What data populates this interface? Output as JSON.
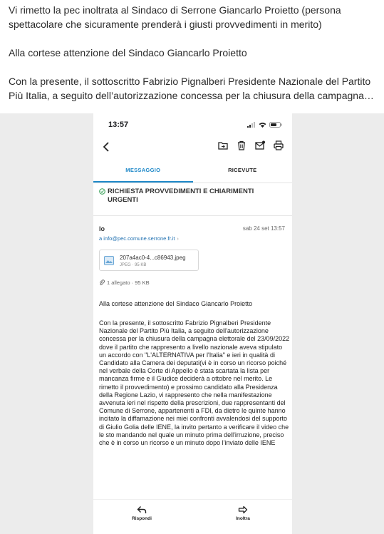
{
  "post": {
    "paragraph1": "Vi rimetto la pec inoltrata al Sindaco di Serrone Giancarlo Proietto (persona spettacolare che sicuramente prenderà i giusti provvedimenti in merito)",
    "paragraph2": "Alla cortese attenzione del Sindaco Giancarlo Proietto",
    "paragraph3": "Con la presente, il sottoscritto Fabrizio Pignalberi Presidente Nazionale del Partito Più Italia, a seguito dell’autorizzazione concessa per la chiusura della campagna…"
  },
  "phone": {
    "status_time": "13:57",
    "tabs": [
      "MESSAGGIO",
      "RICEVUTE"
    ],
    "subject": "RICHIESTA PROVVEDIMENTI E CHIARIMENTI URGENTI",
    "sender": "Io",
    "date": "sab 24 set 13:57",
    "recipient": "a info@pec.comune.serrone.fr.it",
    "recipient_arrow": "›",
    "attachment": {
      "name": "207a4ac0-4...c86943.jpeg",
      "meta": "JPEG · 95 KB",
      "icon": "image-file-icon"
    },
    "attachment_count": "1 allegato · 95 KB",
    "greeting": "Alla cortese attenzione del Sindaco Giancarlo Proietto",
    "body": "Con la presente, il sottoscritto Fabrizio Pignalberi Presidente Nazionale del Partito Più Italia, a seguito dell'autorizzazione concessa per la chiusura della campagna elettorale del 23/09/2022 dove il partito che rappresento a livello nazionale aveva stipulato un accordo con \"L'ALTERNATIVA per l'Italia\" e ieri in qualità di Candidato alla Camera dei deputati(vi è in corso un ricorso poiché nel verbale della Corte di Appello è stata scartata la lista per mancanza firme e il Giudice deciderà a ottobre nel merito. Le rimetto il provvedimento) e prossimo candidato alla Presidenza della Regione Lazio, vi rappresento che nella manifestazione avvenuta ieri nel rispetto della prescrizioni, due rappresentanti del Comune di Serrone, appartenenti a FDI, da dietro le quinte hanno incitato la diffamazione nei miei confronti avvalendosi del supporto di Giulio Golia delle IENE, la invito pertanto a verificare il video che le sto mandando nel quale un minuto prima dell'irruzione, preciso che è in corso un ricorso e un minuto dopo l'inviato delle IENE",
    "actions": {
      "reply": "Rispondi",
      "forward": "Inoltra"
    },
    "colors": {
      "accent": "#1e88c8",
      "success": "#2e9d4f"
    }
  }
}
